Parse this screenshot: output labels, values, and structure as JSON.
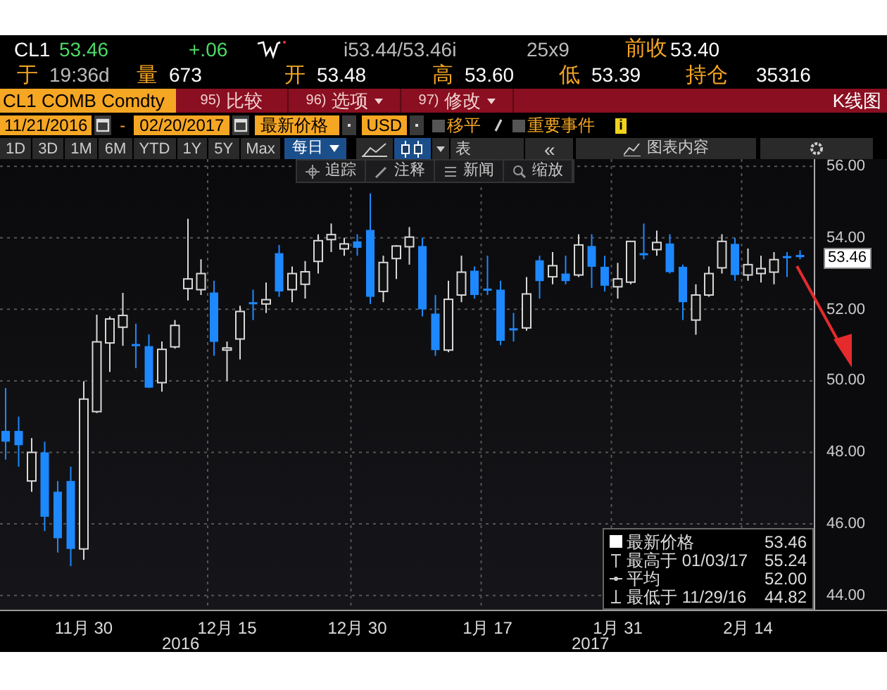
{
  "quote": {
    "ticker": "CL1",
    "last": "53.46",
    "change": "+.06",
    "bid_ask": "i53.44/53.46i",
    "size": "25x9",
    "prev_close_label": "前收",
    "prev_close": "53.40"
  },
  "stats": [
    {
      "label": "于",
      "value": "19:36d"
    },
    {
      "label": "量",
      "value": "673"
    },
    {
      "label": "开",
      "value": "53.48"
    },
    {
      "label": "高",
      "value": "53.60"
    },
    {
      "label": "低",
      "value": "53.39"
    },
    {
      "label": "持仓",
      "value": "35316"
    }
  ],
  "security": "CL1 COMB Comdty",
  "menu": [
    {
      "number": "95)",
      "label": "比较",
      "dropdown": false
    },
    {
      "number": "96)",
      "label": "选项",
      "dropdown": true
    },
    {
      "number": "97)",
      "label": "修改",
      "dropdown": true
    }
  ],
  "chart_name": "K线图",
  "start_date": "11/21/2016",
  "date_separator": "-",
  "end_date": "02/20/2017",
  "field": "最新价格",
  "currency": "USD",
  "toggles": [
    {
      "label": "移平",
      "checked": false
    },
    {
      "label": "重要事件",
      "checked": false
    }
  ],
  "info_badge": "i",
  "periods": [
    {
      "label": "1D",
      "selected": false
    },
    {
      "label": "3D",
      "selected": false
    },
    {
      "label": "1M",
      "selected": false
    },
    {
      "label": "6M",
      "selected": false
    },
    {
      "label": "YTD",
      "selected": false
    },
    {
      "label": "1Y",
      "selected": false
    },
    {
      "label": "5Y",
      "selected": false
    },
    {
      "label": "Max",
      "selected": false
    }
  ],
  "frequency": "每日",
  "chart_types": [
    {
      "kind": "line",
      "selected": false
    },
    {
      "kind": "candle",
      "selected": true
    }
  ],
  "table_label": "表",
  "collapse": "«",
  "contents_label": "图表内容",
  "tools": [
    {
      "kind": "track",
      "label": "追踪"
    },
    {
      "kind": "annotate",
      "label": "注释"
    },
    {
      "kind": "news",
      "label": "新闻"
    },
    {
      "kind": "zoom",
      "label": "缩放"
    }
  ],
  "chart": {
    "last_price_tag": "53.46",
    "years": [
      "2016",
      "2017"
    ],
    "legend": [
      {
        "kind": "last",
        "label": "最新价格",
        "value": "53.46"
      },
      {
        "kind": "high",
        "label": "最高于 01/03/17",
        "value": "55.24"
      },
      {
        "kind": "average",
        "label": "平均",
        "value": "52.00"
      },
      {
        "kind": "low",
        "label": "最低于 11/29/16",
        "value": "44.82"
      }
    ],
    "chart_data": {
      "type": "candlestick",
      "grid": true,
      "categories": [
        null,
        null,
        null,
        null,
        null,
        null,
        "11月 30",
        null,
        null,
        null,
        null,
        null,
        null,
        null,
        null,
        null,
        null,
        "12月 15",
        null,
        null,
        null,
        null,
        null,
        null,
        null,
        null,
        null,
        "12月 30",
        null,
        null,
        null,
        null,
        null,
        null,
        null,
        null,
        null,
        "1月 17",
        null,
        null,
        null,
        null,
        null,
        null,
        null,
        null,
        null,
        "1月 31",
        null,
        null,
        null,
        null,
        null,
        null,
        null,
        null,
        null,
        "2月 14",
        null,
        null,
        null,
        null
      ],
      "ylim": [
        43.6,
        56.2
      ],
      "yticks": [
        {
          "value": 44,
          "label": "44.00"
        },
        {
          "value": 46,
          "label": "46.00"
        },
        {
          "value": 48,
          "label": "48.00"
        },
        {
          "value": 50,
          "label": "50.00"
        },
        {
          "value": 52,
          "label": "52.00"
        },
        {
          "value": 54,
          "label": "54.00"
        },
        {
          "value": 56,
          "label": "56.00"
        }
      ],
      "ohlc": [
        [
          48.6,
          49.8,
          47.8,
          48.3
        ],
        [
          48.6,
          49.0,
          47.6,
          48.2
        ],
        [
          47.2,
          48.4,
          46.9,
          48.0
        ],
        [
          48.0,
          48.3,
          45.8,
          46.2
        ],
        [
          46.9,
          47.2,
          45.2,
          45.6
        ],
        [
          47.2,
          47.6,
          44.82,
          45.3
        ],
        [
          45.3,
          49.99,
          45.0,
          49.49
        ],
        [
          49.14,
          51.85,
          49.1,
          51.09
        ],
        [
          51.06,
          51.8,
          50.25,
          51.73
        ],
        [
          51.5,
          52.46,
          50.98,
          51.83
        ],
        [
          51.03,
          51.6,
          50.36,
          50.97
        ],
        [
          50.97,
          51.3,
          49.8,
          49.81
        ],
        [
          49.95,
          51.1,
          49.7,
          50.88
        ],
        [
          50.95,
          51.7,
          50.9,
          51.55
        ],
        [
          52.58,
          54.53,
          52.25,
          52.85
        ],
        [
          52.55,
          53.4,
          52.4,
          53.0
        ],
        [
          52.47,
          52.8,
          50.7,
          51.09
        ],
        [
          50.86,
          51.1,
          50.0,
          50.92
        ],
        [
          51.17,
          52.1,
          50.6,
          51.94
        ],
        [
          52.2,
          52.55,
          51.7,
          52.15
        ],
        [
          52.15,
          52.75,
          51.9,
          52.27
        ],
        [
          53.57,
          53.8,
          52.35,
          52.5
        ],
        [
          52.55,
          53.2,
          52.2,
          53.0
        ],
        [
          52.7,
          53.35,
          52.3,
          53.05
        ],
        [
          53.34,
          54.1,
          53.0,
          53.92
        ],
        [
          53.95,
          54.4,
          53.6,
          54.09
        ],
        [
          53.69,
          54.0,
          53.5,
          53.83
        ],
        [
          53.9,
          54.1,
          53.5,
          53.72
        ],
        [
          54.22,
          55.24,
          52.15,
          52.35
        ],
        [
          52.5,
          53.5,
          52.2,
          53.31
        ],
        [
          53.42,
          53.8,
          52.85,
          53.77
        ],
        [
          53.75,
          54.3,
          53.25,
          54.02
        ],
        [
          53.77,
          54.0,
          51.8,
          52.0
        ],
        [
          51.88,
          52.4,
          50.7,
          50.86
        ],
        [
          50.86,
          52.8,
          50.8,
          52.28
        ],
        [
          52.4,
          53.5,
          52.2,
          53.04
        ],
        [
          53.08,
          53.2,
          52.3,
          52.4
        ],
        [
          52.58,
          53.5,
          52.4,
          52.52
        ],
        [
          52.55,
          52.8,
          51.0,
          51.12
        ],
        [
          51.47,
          51.9,
          51.1,
          51.41
        ],
        [
          51.48,
          52.9,
          51.4,
          52.43
        ],
        [
          53.37,
          53.5,
          52.3,
          52.79
        ],
        [
          52.91,
          53.6,
          52.7,
          53.22
        ],
        [
          53.0,
          53.5,
          52.7,
          52.79
        ],
        [
          52.96,
          54.1,
          52.9,
          53.8
        ],
        [
          53.77,
          54.1,
          52.6,
          53.19
        ],
        [
          53.19,
          53.5,
          52.5,
          52.66
        ],
        [
          52.63,
          53.3,
          52.3,
          52.85
        ],
        [
          52.76,
          53.9,
          52.7,
          53.9
        ],
        [
          53.57,
          54.4,
          53.4,
          53.52
        ],
        [
          53.67,
          54.2,
          53.5,
          53.87
        ],
        [
          53.84,
          54.1,
          53.0,
          53.04
        ],
        [
          53.19,
          53.25,
          51.7,
          52.2
        ],
        [
          51.7,
          52.7,
          51.29,
          52.4
        ],
        [
          52.4,
          53.2,
          52.35,
          53.0
        ],
        [
          53.16,
          54.1,
          53.0,
          53.9
        ],
        [
          53.83,
          54.0,
          52.8,
          52.96
        ],
        [
          52.96,
          53.7,
          52.8,
          53.25
        ],
        [
          53.0,
          53.5,
          52.75,
          53.14
        ],
        [
          53.04,
          53.6,
          52.7,
          53.39
        ],
        [
          53.49,
          53.6,
          52.9,
          53.43
        ],
        [
          53.52,
          53.65,
          53.4,
          53.46
        ]
      ]
    }
  }
}
